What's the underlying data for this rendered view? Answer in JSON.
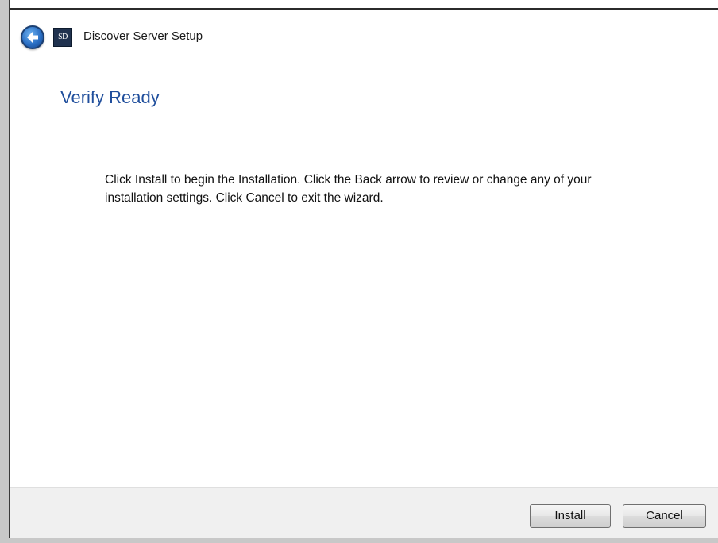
{
  "window": {
    "title": "Discover Server Setup",
    "app_icon_text": "SD"
  },
  "icons": {
    "back": "back-arrow-icon",
    "app": "app-logo-icon"
  },
  "page": {
    "heading": "Verify Ready",
    "description": "Click Install to begin the Installation. Click the Back arrow to review or change any of your installation settings. Click Cancel to exit the wizard."
  },
  "footer": {
    "install_label": "Install",
    "cancel_label": "Cancel"
  },
  "colors": {
    "heading": "#1f4e9c",
    "back_button": "#2a6fc4"
  }
}
